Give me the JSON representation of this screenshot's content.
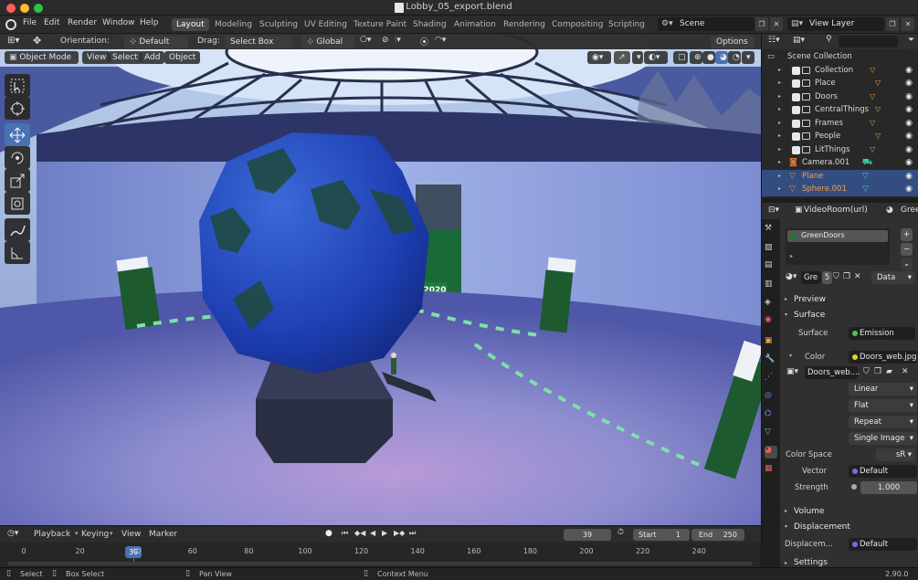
{
  "window": {
    "title": "Lobby_05_export.blend"
  },
  "menu": [
    "File",
    "Edit",
    "Render",
    "Window",
    "Help"
  ],
  "workspaces": [
    "Layout",
    "Modeling",
    "Sculpting",
    "UV Editing",
    "Texture Paint",
    "Shading",
    "Animation",
    "Rendering",
    "Compositing",
    "Scripting"
  ],
  "scene": {
    "name": "Scene",
    "view_layer": "View Layer"
  },
  "tool_header": {
    "orientation_label": "Orientation:",
    "orientation_value": "Default",
    "drag_label": "Drag:",
    "drag_value": "Select Box",
    "transform_value": "Global",
    "options_label": "Options"
  },
  "viewport_header": {
    "mode": "Object Mode",
    "menus": [
      "View",
      "Select",
      "Add",
      "Object"
    ]
  },
  "scene_labels": {
    "sign": "2020"
  },
  "outliner": {
    "root": "Scene Collection",
    "items": [
      {
        "label": "Collection",
        "type": "collection",
        "selected": false
      },
      {
        "label": "Place",
        "type": "collection",
        "selected": false
      },
      {
        "label": "Doors",
        "type": "collection",
        "selected": false
      },
      {
        "label": "CentralThings",
        "type": "collection",
        "selected": false
      },
      {
        "label": "Frames",
        "type": "collection",
        "selected": false
      },
      {
        "label": "People",
        "type": "collection",
        "selected": false
      },
      {
        "label": "LitThings",
        "type": "collection",
        "selected": false
      },
      {
        "label": "Camera.001",
        "type": "camera",
        "selected": false
      },
      {
        "label": "Plane",
        "type": "mesh",
        "selected": true
      },
      {
        "label": "Sphere.001",
        "type": "mesh",
        "selected": true
      }
    ]
  },
  "properties": {
    "object_name": "VideoRoom(url)",
    "material_short": "Gree",
    "material_slot": "GreenDoors",
    "material_field": "Gre",
    "user_count": "5",
    "data_dropdown": "Data",
    "sections": {
      "preview": "Preview",
      "surface": "Surface",
      "volume": "Volume",
      "displacement": "Displacement",
      "settings": "Settings"
    },
    "surface_label": "Surface",
    "surface_value": "Emission",
    "color_label": "Color",
    "color_value": "Doors_web.jpg",
    "image_name": "Doors_web....",
    "interpolation": "Linear",
    "projection": "Flat",
    "extension": "Repeat",
    "source": "Single Image",
    "color_space_label": "Color Space",
    "color_space_value": "sR",
    "vector_label": "Vector",
    "vector_value": "Default",
    "strength_label": "Strength",
    "strength_value": "1.000",
    "displacement_label": "Displacem...",
    "displacement_value": "Default"
  },
  "timeline": {
    "menus": [
      "Playback",
      "Keying",
      "View",
      "Marker"
    ],
    "current_frame": "39",
    "start_label": "Start",
    "start_value": "1",
    "end_label": "End",
    "end_value": "250",
    "ticks": [
      "0",
      "20",
      "40",
      "60",
      "80",
      "100",
      "120",
      "140",
      "160",
      "180",
      "200",
      "220",
      "240"
    ],
    "cursor": "39"
  },
  "statusbar": {
    "select": "Select",
    "box_select": "Box Select",
    "pan_view": "Pan View",
    "context_menu": "Context Menu",
    "version": "2.90.0"
  },
  "colors": {
    "accent": "#4772b3",
    "selection": "#334d80",
    "collection_icon": "#e8a040",
    "camera_icon": "#e07830",
    "mesh_icon": "#e08a3c"
  }
}
